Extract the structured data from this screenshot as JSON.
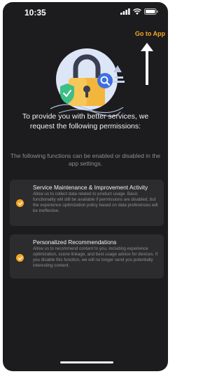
{
  "status_bar": {
    "time": "10:35",
    "icons": [
      "cellular-signal-icon",
      "wifi-icon",
      "battery-icon"
    ]
  },
  "header": {
    "go_to_app": "Go to App"
  },
  "main": {
    "headline": "To provide you with better services, we request the following permissions:",
    "subline": "The following functions can be enabled or disabled in the app settings.",
    "permissions": [
      {
        "title": "Service Maintenance & Improvement Activity",
        "description": "Allow us to collect data related to product usage. Basic functionality will still be available if permissions are disabled, but the experience optimization policy based on data preferences will be ineffective.",
        "checked": true
      },
      {
        "title": "Personalized Recommendations",
        "description": "Allow us to recommend content to you, including experience optimization, scene linkage, and best usage advice for devices. If you disable this function, we will no longer send you potentially interesting content.",
        "checked": true
      }
    ]
  },
  "colors": {
    "background": "#1c1c1e",
    "card": "#2c2c2e",
    "accent": "#f5a623",
    "muted_text": "#8e8e93"
  }
}
